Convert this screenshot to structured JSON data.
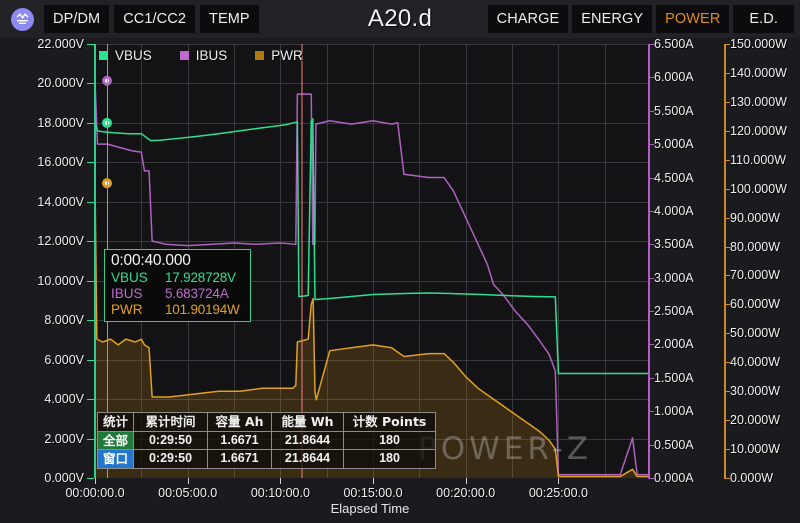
{
  "header": {
    "logo_icon": "power-meter-icon",
    "left_buttons": [
      {
        "label": "DP/DM",
        "active": false
      },
      {
        "label": "CC1/CC2",
        "active": false
      },
      {
        "label": "TEMP",
        "active": false
      }
    ],
    "title": "A20.d",
    "right_buttons": [
      {
        "label": "CHARGE",
        "active": false
      },
      {
        "label": "ENERGY",
        "active": false
      },
      {
        "label": "POWER",
        "active": true
      },
      {
        "label": "E.D.",
        "active": false
      }
    ],
    "accent_color": "#e08a20"
  },
  "legend": [
    {
      "label": "VBUS",
      "color": "#2ee08f"
    },
    {
      "label": "IBUS",
      "color": "#c06ad0"
    },
    {
      "label": "PWR",
      "color": "#b07a10"
    }
  ],
  "tooltip": {
    "time": "0:00:40.000",
    "rows": [
      {
        "key": "VBUS",
        "value": "17.928728V",
        "color": "#2ee08f"
      },
      {
        "key": "IBUS",
        "value": "5.683724A",
        "color": "#c06ad0"
      },
      {
        "key": "PWR",
        "value": "101.90194W",
        "color": "#e0a020"
      }
    ]
  },
  "stats_table": {
    "headers": [
      "统计",
      "累计时间",
      "容量 Ah",
      "能量 Wh",
      "计数 Points"
    ],
    "rows": [
      {
        "tag": "全部",
        "tag_style": "all",
        "cells": [
          "0:29:50",
          "1.6671",
          "21.8644",
          "180"
        ]
      },
      {
        "tag": "窗口",
        "tag_style": "win",
        "cells": [
          "0:29:50",
          "1.6671",
          "21.8644",
          "180"
        ]
      }
    ]
  },
  "watermark": "POWER-Z",
  "chart_data": {
    "type": "line",
    "title": "A20.d",
    "xlabel": "Elapsed Time",
    "xlim": [
      0,
      1790
    ],
    "x_tick_labels": [
      "00:00:00.0",
      "00:05:00.0",
      "00:10:00.0",
      "00:15:00.0",
      "00:20:00.0",
      "00:25:00.0"
    ],
    "x_tick_values": [
      0,
      300,
      600,
      900,
      1200,
      1500
    ],
    "grid": true,
    "legend_position": "top-left",
    "axes": [
      {
        "name": "VBUS",
        "side": "left",
        "unit": "V",
        "color": "#2ee08f",
        "ylim": [
          0,
          22
        ],
        "ticks": [
          0,
          2,
          4,
          6,
          8,
          10,
          12,
          14,
          16,
          18,
          20,
          22
        ],
        "tick_labels": [
          "0.000V",
          "2.000V",
          "4.000V",
          "6.000V",
          "8.000V",
          "10.000V",
          "12.000V",
          "14.000V",
          "16.000V",
          "18.000V",
          "20.000V",
          "22.000V"
        ]
      },
      {
        "name": "IBUS",
        "side": "right",
        "unit": "A",
        "color": "#b060c0",
        "ylim": [
          0,
          6.5
        ],
        "ticks": [
          0,
          0.5,
          1,
          1.5,
          2,
          2.5,
          3,
          3.5,
          4,
          4.5,
          5,
          5.5,
          6,
          6.5
        ],
        "tick_labels": [
          "0.000A",
          "0.500A",
          "1.000A",
          "1.500A",
          "2.000A",
          "2.500A",
          "3.000A",
          "3.500A",
          "4.000A",
          "4.500A",
          "5.000A",
          "5.500A",
          "6.000A",
          "6.500A"
        ]
      },
      {
        "name": "PWR",
        "side": "right2",
        "unit": "W",
        "color": "#d08a1e",
        "ylim": [
          0,
          150
        ],
        "ticks": [
          0,
          10,
          20,
          30,
          40,
          50,
          60,
          70,
          80,
          90,
          100,
          110,
          120,
          130,
          140,
          150
        ],
        "tick_labels": [
          "0.000W",
          "10.000W",
          "20.000W",
          "30.000W",
          "40.000W",
          "50.000W",
          "60.000W",
          "70.000W",
          "80.000W",
          "90.000W",
          "100.000W",
          "110.000W",
          "120.000W",
          "130.000W",
          "140.000W",
          "150.000W"
        ]
      }
    ],
    "series": [
      {
        "name": "VBUS",
        "axis": "left",
        "color": "#2ee08f",
        "marker_start": {
          "x": 0,
          "y": 18.0
        },
        "points": [
          [
            0,
            18.0
          ],
          [
            8,
            17.6
          ],
          [
            25,
            17.55
          ],
          [
            60,
            17.5
          ],
          [
            110,
            17.45
          ],
          [
            150,
            17.45
          ],
          [
            180,
            17.1
          ],
          [
            210,
            17.12
          ],
          [
            260,
            17.2
          ],
          [
            320,
            17.3
          ],
          [
            400,
            17.45
          ],
          [
            470,
            17.6
          ],
          [
            540,
            17.75
          ],
          [
            615,
            17.9
          ],
          [
            655,
            18.05
          ],
          [
            660,
            9.2
          ],
          [
            663,
            9.2
          ],
          [
            690,
            9.25
          ],
          [
            700,
            18.1
          ],
          [
            705,
            18.2
          ],
          [
            712,
            9.05
          ],
          [
            715,
            9.05
          ],
          [
            760,
            9.1
          ],
          [
            830,
            9.2
          ],
          [
            900,
            9.3
          ],
          [
            1000,
            9.35
          ],
          [
            1080,
            9.38
          ],
          [
            1150,
            9.35
          ],
          [
            1250,
            9.3
          ],
          [
            1330,
            9.25
          ],
          [
            1420,
            9.2
          ],
          [
            1490,
            9.18
          ],
          [
            1500,
            5.3
          ],
          [
            1560,
            5.3
          ],
          [
            1680,
            5.3
          ],
          [
            1760,
            5.3
          ],
          [
            1790,
            5.3
          ]
        ]
      },
      {
        "name": "IBUS",
        "axis": "right",
        "color": "#b060c0",
        "marker_start": {
          "x": 0,
          "y": 5.95
        },
        "points": [
          [
            0,
            5.95
          ],
          [
            8,
            5.0
          ],
          [
            40,
            5.0
          ],
          [
            80,
            4.95
          ],
          [
            120,
            4.9
          ],
          [
            150,
            4.88
          ],
          [
            160,
            4.6
          ],
          [
            175,
            4.6
          ],
          [
            185,
            3.55
          ],
          [
            230,
            3.5
          ],
          [
            300,
            3.48
          ],
          [
            380,
            3.5
          ],
          [
            450,
            3.52
          ],
          [
            520,
            3.5
          ],
          [
            600,
            3.52
          ],
          [
            650,
            3.5
          ],
          [
            655,
            5.75
          ],
          [
            700,
            5.75
          ],
          [
            705,
            3.5
          ],
          [
            712,
            3.5
          ],
          [
            715,
            5.3
          ],
          [
            760,
            5.35
          ],
          [
            830,
            5.3
          ],
          [
            900,
            5.35
          ],
          [
            960,
            5.3
          ],
          [
            980,
            5.32
          ],
          [
            1000,
            4.55
          ],
          [
            1080,
            4.5
          ],
          [
            1130,
            4.5
          ],
          [
            1160,
            4.3
          ],
          [
            1200,
            3.9
          ],
          [
            1240,
            3.5
          ],
          [
            1270,
            3.2
          ],
          [
            1290,
            2.9
          ],
          [
            1320,
            2.75
          ],
          [
            1360,
            2.5
          ],
          [
            1400,
            2.3
          ],
          [
            1440,
            2.05
          ],
          [
            1470,
            1.85
          ],
          [
            1490,
            1.6
          ],
          [
            1500,
            0.05
          ],
          [
            1620,
            0.05
          ],
          [
            1700,
            0.05
          ],
          [
            1740,
            0.6
          ],
          [
            1755,
            0.05
          ],
          [
            1790,
            0.05
          ]
        ]
      },
      {
        "name": "PWR",
        "axis": "right2",
        "color": "#e0a020",
        "marker_start": {
          "x": 0,
          "y": 101.9
        },
        "fill": true,
        "points": [
          [
            0,
            101.9
          ],
          [
            6,
            48
          ],
          [
            25,
            47
          ],
          [
            50,
            48
          ],
          [
            75,
            46
          ],
          [
            100,
            48
          ],
          [
            130,
            47
          ],
          [
            150,
            48
          ],
          [
            160,
            46
          ],
          [
            175,
            45
          ],
          [
            185,
            28
          ],
          [
            240,
            28
          ],
          [
            320,
            29
          ],
          [
            400,
            30
          ],
          [
            470,
            30
          ],
          [
            540,
            31
          ],
          [
            600,
            31
          ],
          [
            640,
            31
          ],
          [
            650,
            32
          ],
          [
            655,
            47
          ],
          [
            690,
            48
          ],
          [
            700,
            60
          ],
          [
            706,
            62
          ],
          [
            712,
            30
          ],
          [
            716,
            27
          ],
          [
            760,
            44
          ],
          [
            830,
            45
          ],
          [
            900,
            46
          ],
          [
            960,
            45
          ],
          [
            1000,
            42
          ],
          [
            1080,
            43
          ],
          [
            1130,
            43
          ],
          [
            1160,
            40
          ],
          [
            1200,
            35
          ],
          [
            1240,
            31
          ],
          [
            1280,
            28
          ],
          [
            1320,
            25
          ],
          [
            1360,
            22
          ],
          [
            1400,
            19
          ],
          [
            1440,
            16
          ],
          [
            1470,
            13
          ],
          [
            1490,
            10
          ],
          [
            1500,
            0.5
          ],
          [
            1620,
            0.5
          ],
          [
            1700,
            0.5
          ],
          [
            1740,
            3
          ],
          [
            1755,
            0.5
          ],
          [
            1790,
            0.5
          ]
        ]
      }
    ],
    "cursor": {
      "x": 40,
      "time": "0:00:40.000",
      "vbus": 17.928728,
      "ibus": 5.683724,
      "pwr": 101.90194
    }
  }
}
